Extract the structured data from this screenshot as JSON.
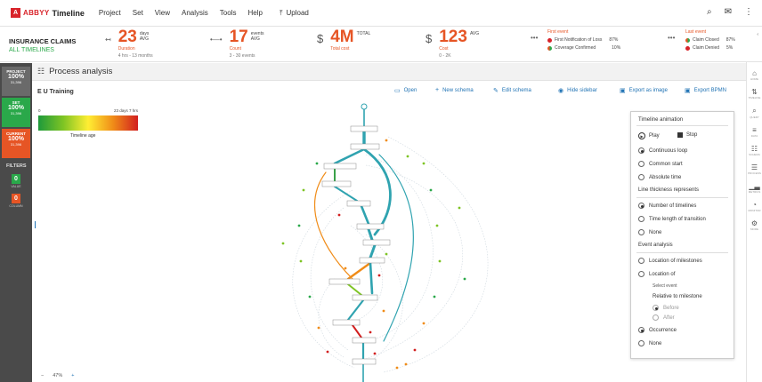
{
  "app": {
    "logo_mark": "A",
    "brand": "ABBYY",
    "product": "Timeline",
    "menu": [
      "Project",
      "Set",
      "View",
      "Analysis",
      "Tools",
      "Help"
    ],
    "upload_label": "Upload"
  },
  "kpis": {
    "dataset_title": "INSURANCE CLAIMS",
    "dataset_filter": "ALL TIMELINES",
    "duration": {
      "value": "23",
      "unit1": "days",
      "unit2": "AVG",
      "label": "Duration",
      "sub": "4 hrs - 13 months"
    },
    "count": {
      "value": "17",
      "unit1": "events",
      "unit2": "AVG",
      "label": "Count",
      "sub": "3 - 30 events"
    },
    "total": {
      "symbol": "$",
      "value": "4M",
      "unit1": "TOTAL",
      "label": "Total cost"
    },
    "cost": {
      "symbol": "$",
      "value": "123",
      "unit1": "AVG",
      "label": "Cost",
      "sub": "0 - 2K"
    },
    "first_event": {
      "title": "First event",
      "rows": [
        {
          "name": "First Notification of Loss",
          "pct": "87%"
        },
        {
          "name": "Coverage Confirmed",
          "pct": "10%"
        }
      ]
    },
    "last_event": {
      "title": "Last event",
      "rows": [
        {
          "name": "Claim Closed",
          "pct": "87%"
        },
        {
          "name": "Claim Denied",
          "pct": "5%"
        }
      ]
    }
  },
  "left_panel": {
    "project": {
      "label": "PROJECT",
      "pct": "100%",
      "count": "31,396"
    },
    "set": {
      "label": "SET",
      "pct": "100%",
      "count": "31,396"
    },
    "current": {
      "label": "CURRENT",
      "pct": "100%",
      "count": "31,396"
    },
    "filters_label": "FILTERS",
    "filters": [
      {
        "value": "0",
        "label": "VALUE",
        "color": "#2aa84a"
      },
      {
        "value": "0",
        "label": "COLUMN",
        "color": "#e65525"
      }
    ]
  },
  "process": {
    "title": "Process analysis",
    "name": "E U Training",
    "tools": {
      "open": "Open",
      "new_schema": "New schema",
      "edit_schema": "Edit schema",
      "hide_sidebar": "Hide sidebar",
      "export_image": "Export as image",
      "export_bpmn": "Export BPMN"
    },
    "legend": {
      "min": "0",
      "max": "23 days 7 hrs",
      "title": "Timeline age"
    },
    "zoom": {
      "minus": "−",
      "level": "47%",
      "plus": "+"
    }
  },
  "animation_panel": {
    "title": "Timeline animation",
    "play": "Play",
    "stop": "Stop",
    "mode_options": [
      "Continuous loop",
      "Common start",
      "Absolute time"
    ],
    "mode_selected": 0,
    "thickness_title": "Line thickness represents",
    "thickness_options": [
      "Number of timelines",
      "Time length of transition",
      "None"
    ],
    "thickness_selected": 0,
    "event_title": "Event analysis",
    "event_options": [
      "Location of milestones",
      "Location of"
    ],
    "select_event": "Select event",
    "relative_title": "Relative to milestone",
    "relative_options": [
      "Before",
      "After"
    ],
    "occ_options": [
      "Occurrence",
      "None"
    ],
    "occ_selected": 0
  },
  "right_rail": [
    "HOME",
    "TIMELINE",
    "QUERY",
    "DATA",
    "SCHEMA",
    "PROCESS",
    "METRICS",
    "MONITOR",
    "MORE"
  ],
  "colors": {
    "accent": "#e65525",
    "brand": "#d8232a",
    "link": "#2274b5",
    "green": "#2aa84a"
  }
}
